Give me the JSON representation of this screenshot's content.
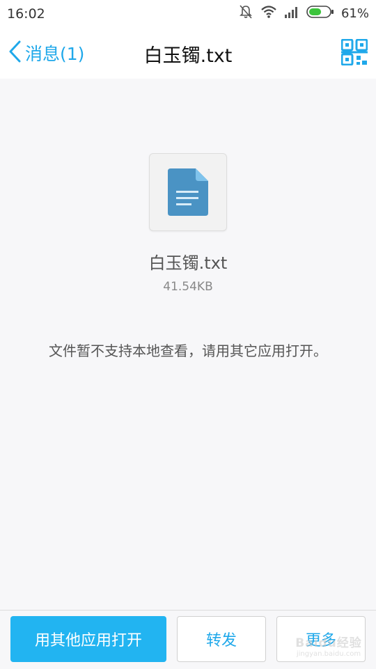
{
  "status": {
    "time": "16:02",
    "battery_percent": "61%",
    "battery_level": 0.61,
    "icons": [
      "bell-off-icon",
      "wifi-icon",
      "signal-icon",
      "battery-icon"
    ]
  },
  "nav": {
    "back_label": "消息(1)",
    "title": "白玉镯.txt",
    "right_icon": "qr-code-icon"
  },
  "file": {
    "icon": "text-document-icon",
    "name": "白玉镯.txt",
    "size": "41.54KB"
  },
  "message": "文件暂不支持本地查看，请用其它应用打开。",
  "actions": {
    "open_other": "用其他应用打开",
    "forward": "转发",
    "more": "更多"
  },
  "watermark": {
    "line1": "Baidu经验",
    "line2": "jingyan.baidu.com"
  },
  "colors": {
    "accent": "#1fa8ea",
    "primary_button": "#22b4f1",
    "file_icon": "#4a93c4",
    "file_icon_fold": "#7fc3ec",
    "battery_fill": "#3cc43c"
  }
}
